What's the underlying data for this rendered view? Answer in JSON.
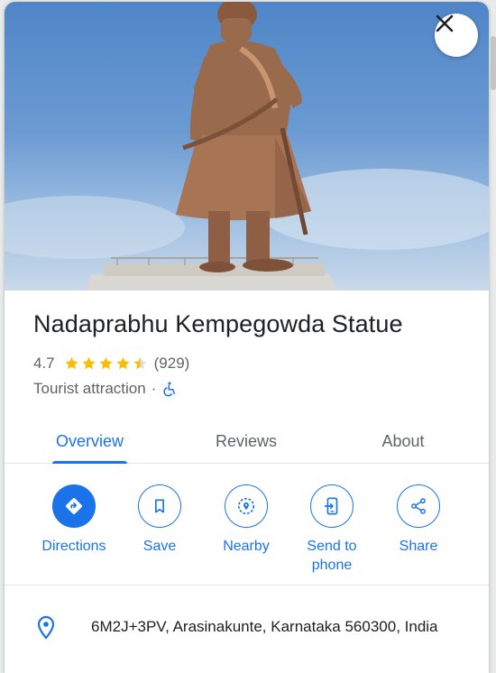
{
  "place": {
    "name": "Nadaprabhu Kempegowda Statue",
    "rating": "4.7",
    "stars_filled": 4.5,
    "review_count": "(929)",
    "category": "Tourist attraction",
    "separator": "·",
    "accessibility_icon": "wheelchair-icon"
  },
  "tabs": [
    {
      "label": "Overview",
      "active": true
    },
    {
      "label": "Reviews",
      "active": false
    },
    {
      "label": "About",
      "active": false
    }
  ],
  "actions": [
    {
      "label": "Directions",
      "icon": "directions-icon"
    },
    {
      "label": "Save",
      "icon": "bookmark-icon"
    },
    {
      "label": "Nearby",
      "icon": "nearby-icon"
    },
    {
      "label": "Send to phone",
      "icon": "send-to-phone-icon"
    },
    {
      "label": "Share",
      "icon": "share-icon"
    }
  ],
  "address": {
    "text": "6M2J+3PV, Arasinakunte, Karnataka 560300, India",
    "icon": "location-pin-icon"
  },
  "colors": {
    "accent": "#1a73e8",
    "star": "#fbbc04",
    "text_primary": "#202124",
    "text_secondary": "#5f6368"
  }
}
